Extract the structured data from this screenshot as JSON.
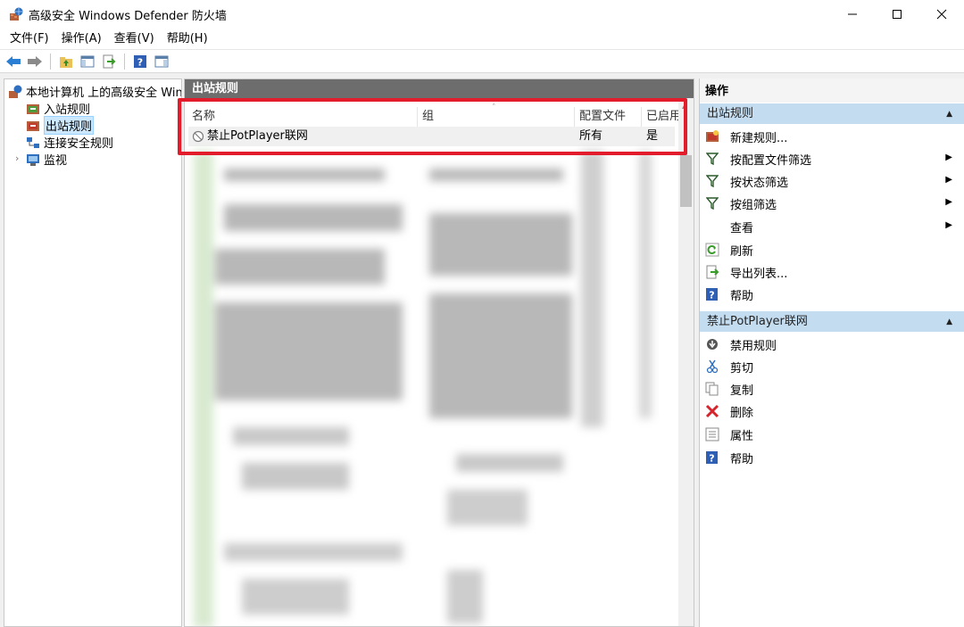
{
  "window": {
    "title": "高级安全 Windows Defender 防火墙",
    "minimize_icon": "minimize-icon",
    "maximize_icon": "maximize-icon",
    "close_icon": "close-icon"
  },
  "menubar": {
    "items": [
      {
        "label": "文件(F)"
      },
      {
        "label": "操作(A)"
      },
      {
        "label": "查看(V)"
      },
      {
        "label": "帮助(H)"
      }
    ]
  },
  "toolbar": {
    "icons": [
      "back-icon",
      "forward-icon",
      "up-folder-icon",
      "show-hide-tree-icon",
      "export-list-icon",
      "help-icon",
      "show-hide-action-pane-icon"
    ]
  },
  "tree": {
    "root": {
      "label": "本地计算机 上的高级安全 Windows Defender 防火墙",
      "icon": "firewall-icon"
    },
    "items": [
      {
        "label": "入站规则",
        "icon": "inbound-rules-icon"
      },
      {
        "label": "出站规则",
        "icon": "outbound-rules-icon",
        "selected": true
      },
      {
        "label": "连接安全规则",
        "icon": "connection-security-icon"
      },
      {
        "label": "监视",
        "icon": "monitoring-icon"
      }
    ]
  },
  "rules_panel": {
    "title": "出站规则",
    "columns": [
      "名称",
      "组",
      "配置文件",
      "已启用"
    ],
    "rows": [
      {
        "name": "禁止PotPlayer联网",
        "group": "",
        "profile": "所有",
        "enabled": "是",
        "icon": "block-icon"
      }
    ]
  },
  "actions": {
    "title": "操作",
    "sections": [
      {
        "title": "出站规则",
        "items": [
          {
            "label": "新建规则...",
            "icon": "new-rule-icon",
            "submenu": false
          },
          {
            "label": "按配置文件筛选",
            "icon": "filter-icon",
            "submenu": true
          },
          {
            "label": "按状态筛选",
            "icon": "filter-icon",
            "submenu": true
          },
          {
            "label": "按组筛选",
            "icon": "filter-icon",
            "submenu": true
          },
          {
            "label": "查看",
            "icon": "",
            "submenu": true
          },
          {
            "label": "刷新",
            "icon": "refresh-icon",
            "submenu": false
          },
          {
            "label": "导出列表...",
            "icon": "export-icon",
            "submenu": false
          },
          {
            "label": "帮助",
            "icon": "help-icon",
            "submenu": false
          }
        ]
      },
      {
        "title": "禁止PotPlayer联网",
        "items": [
          {
            "label": "禁用规则",
            "icon": "disable-rule-icon",
            "submenu": false
          },
          {
            "label": "剪切",
            "icon": "cut-icon",
            "submenu": false
          },
          {
            "label": "复制",
            "icon": "copy-icon",
            "submenu": false
          },
          {
            "label": "删除",
            "icon": "delete-icon",
            "submenu": false
          },
          {
            "label": "属性",
            "icon": "properties-icon",
            "submenu": false
          },
          {
            "label": "帮助",
            "icon": "help-icon",
            "submenu": false
          }
        ]
      }
    ]
  },
  "colors": {
    "highlight_border": "#e21c2a",
    "section_header": "#c4dcf0",
    "panel_header": "#6d6d6d",
    "selection": "#cce8ff"
  }
}
